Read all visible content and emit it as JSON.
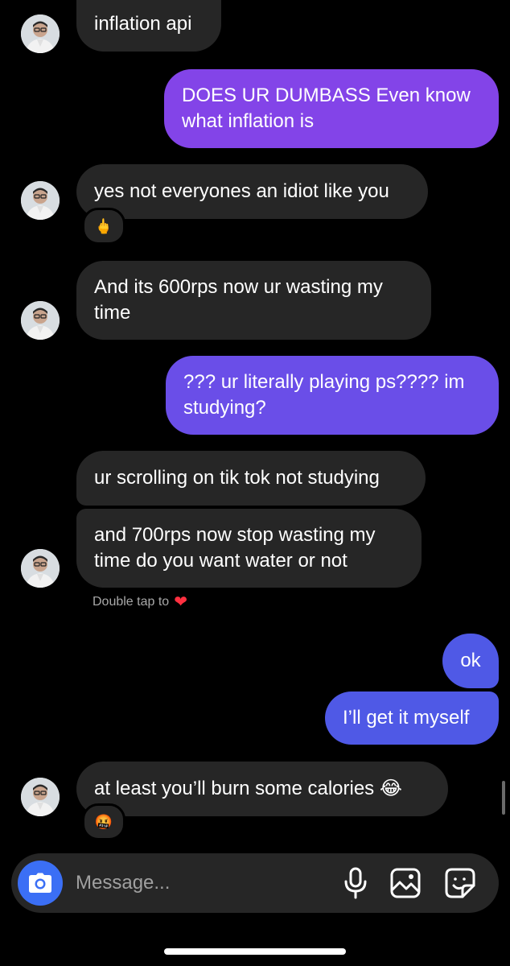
{
  "messages": [
    {
      "dir": "received",
      "text": "inflation api"
    },
    {
      "dir": "sent",
      "text": "DOES UR DUMBASS Even know what inflation is",
      "color": "#8344e8"
    },
    {
      "dir": "received",
      "text": "yes not everyones an idiot like you",
      "reaction": "🖕"
    },
    {
      "dir": "received",
      "text": "And its 600rps now ur wasting my time"
    },
    {
      "dir": "sent",
      "text": "??? ur literally playing ps???? im studying?",
      "color": "#6a4ee8"
    },
    {
      "dir": "received",
      "text": "ur scrolling on tik tok not studying"
    },
    {
      "dir": "received",
      "text": "and 700rps now stop wasting my time do you want water or not"
    },
    {
      "dir": "sent",
      "text": "ok",
      "color": "#4f59e6"
    },
    {
      "dir": "sent",
      "text": "I’ll get it myself",
      "color": "#4f59e6"
    },
    {
      "dir": "received",
      "text": "at least you’ll burn some calories 😂",
      "reaction": "🤬"
    }
  ],
  "hint": {
    "text": "Double tap to",
    "icon": "heart-icon"
  },
  "composer": {
    "placeholder": "Message...",
    "icons": [
      "camera-icon",
      "microphone-icon",
      "gallery-icon",
      "sticker-icon"
    ]
  },
  "colors": {
    "received_bubble": "#262626",
    "camera_button": "#3b6ff5",
    "heart": "#ff3040"
  }
}
